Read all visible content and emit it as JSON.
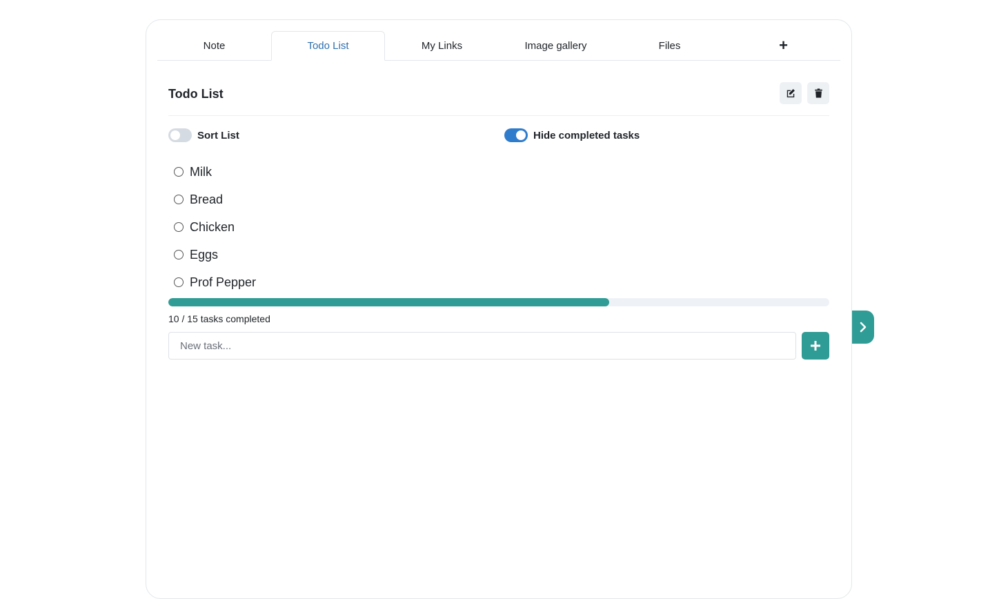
{
  "tabs": [
    {
      "label": "Note",
      "active": false
    },
    {
      "label": "Todo List",
      "active": true
    },
    {
      "label": "My Links",
      "active": false
    },
    {
      "label": "Image gallery",
      "active": false
    },
    {
      "label": "Files",
      "active": false
    },
    {
      "label": "+",
      "active": false
    }
  ],
  "header": {
    "title": "Todo List",
    "edit_icon": "edit-icon",
    "delete_icon": "trash-icon"
  },
  "toggles": {
    "sort_label": "Sort List",
    "sort_on": false,
    "hide_label": "Hide completed tasks",
    "hide_on": true
  },
  "tasks": [
    {
      "label": "Milk",
      "done": false
    },
    {
      "label": "Bread",
      "done": false
    },
    {
      "label": "Chicken",
      "done": false
    },
    {
      "label": "Eggs",
      "done": false
    },
    {
      "label": "Prof Pepper",
      "done": false
    }
  ],
  "progress": {
    "completed": 10,
    "total": 15,
    "text": "10 / 15 tasks completed"
  },
  "new_task": {
    "placeholder": "New task...",
    "value": ""
  },
  "colors": {
    "accent": "#2f9c95",
    "tab_active": "#2f6fae",
    "switch_on": "#2f7ccd"
  }
}
